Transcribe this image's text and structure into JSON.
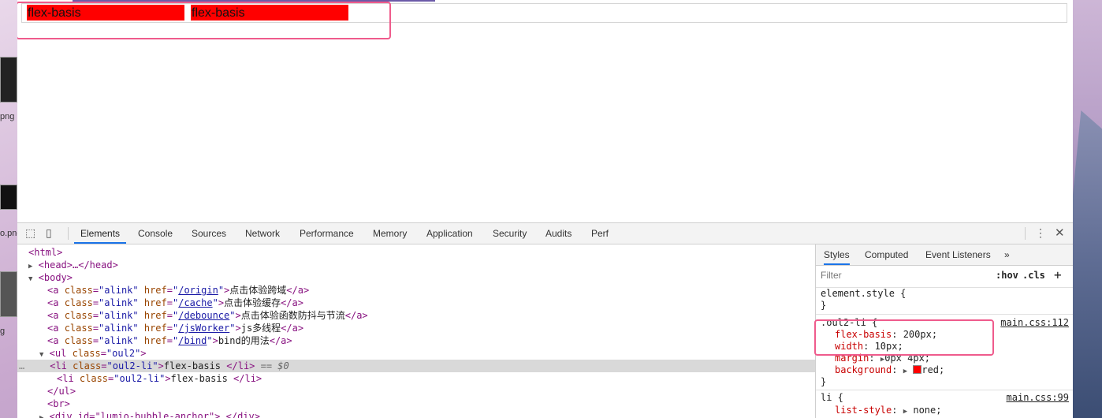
{
  "desktop": {
    "labels": [
      "png",
      "o.png",
      "g"
    ]
  },
  "page": {
    "list_items": [
      "flex-basis",
      "flex-basis"
    ]
  },
  "devtools": {
    "tabs": [
      "Elements",
      "Console",
      "Sources",
      "Network",
      "Performance",
      "Memory",
      "Application",
      "Security",
      "Audits",
      "Perf"
    ],
    "active_tab": "Elements",
    "dom": {
      "html": "<html>",
      "head": "<head>…</head>",
      "body": "<body>",
      "links": [
        {
          "href": "/origin",
          "text": "点击体验跨域"
        },
        {
          "href": "/cache",
          "text": "点击体验缓存"
        },
        {
          "href": "/debounce",
          "text": "点击体验函数防抖与节流"
        },
        {
          "href": "/jsWorker",
          "text": "js多线程"
        },
        {
          "href": "/bind",
          "text": "bind的用法"
        }
      ],
      "ul_class": "oul2",
      "li_class": "oul2-li",
      "li_text": "flex-basis ",
      "selected_suffix": "== $0",
      "ul_close": "</ul>",
      "br": "<br>",
      "last_row": "<div id=\"lumio-bubble-anchor\">…</div>"
    },
    "styles": {
      "tabs": [
        "Styles",
        "Computed",
        "Event Listeners",
        "»"
      ],
      "filter_placeholder": "Filter",
      "hov": ":hov",
      "cls": ".cls",
      "plus": "+",
      "element_style": "element.style {",
      "close_brace": "}",
      "rule1": {
        "selector": ".oul2-li {",
        "source": "main.css:112",
        "decls": [
          {
            "prop": "flex-basis",
            "value": "200px;"
          },
          {
            "prop": "width",
            "value": "10px;"
          },
          {
            "prop": "margin",
            "value": "0px 4px;"
          },
          {
            "prop": "background",
            "value": "red;"
          }
        ]
      },
      "rule2": {
        "selector": "li {",
        "source": "main.css:99",
        "decls": [
          {
            "prop": "list-style",
            "value": "none;"
          }
        ]
      }
    }
  }
}
